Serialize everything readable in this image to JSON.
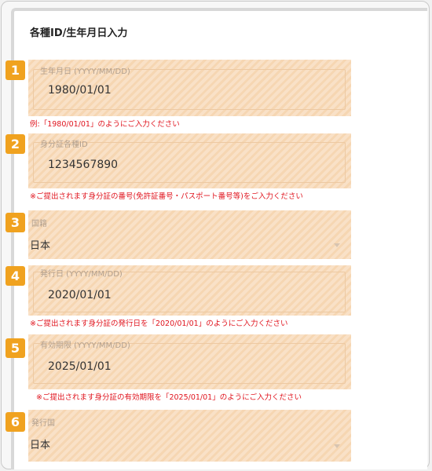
{
  "title": "各種ID/生年月日入力",
  "fields": [
    {
      "num": "1",
      "label": "生年月日 (YYYY/MM/DD)",
      "value": "1980/01/01",
      "note": "例:「1980/01/01」のようにご入力ください"
    },
    {
      "num": "2",
      "label": "身分証各種ID",
      "value": "1234567890",
      "note": "※ご提出されます身分証の番号(免許証番号・パスポート番号等)をご入力ください"
    },
    {
      "num": "3",
      "label": "国籍",
      "value": "日本",
      "note": ""
    },
    {
      "num": "4",
      "label": "発行日 (YYYY/MM/DD)",
      "value": "2020/01/01",
      "note": "※ご提出されます身分証の発行日を「2020/01/01」のようにご入力ください"
    },
    {
      "num": "5",
      "label": "有効期限 (YYYY/MM/DD)",
      "value": "2025/01/01",
      "note": "※ご提出されます身分証の有効期限を「2025/01/01」のようにご入力ください"
    },
    {
      "num": "6",
      "label": "発行国",
      "value": "日本",
      "note": ""
    }
  ],
  "colors": {
    "badge": "#f0a21f",
    "note": "#e0141e",
    "highlight": "#f9e1c7"
  }
}
